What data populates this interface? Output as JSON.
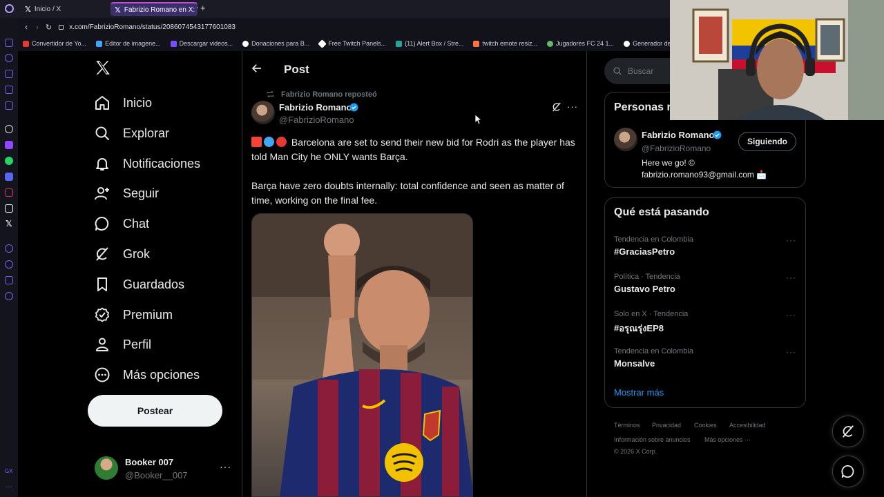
{
  "browser": {
    "tabs": [
      {
        "label": "Inicio / X"
      },
      {
        "label": "Fabrizio Romano en X: \"🚨 !"
      }
    ],
    "url": "x.com/FabrizioRomano/status/2086074543177601083",
    "bookmarks": [
      {
        "label": "Convertidor de Yo...",
        "color": "#e53935"
      },
      {
        "label": "Editor de imagene...",
        "color": "#42a5f5"
      },
      {
        "label": "Descargar videos...",
        "color": "#7c4dff"
      },
      {
        "label": "Donaciones para B...",
        "color": "#ffffff"
      },
      {
        "label": "Free Twitch Panels...",
        "color": "#ffffff"
      },
      {
        "label": "(11) Alert Box / Stre...",
        "color": "#26a69a"
      },
      {
        "label": "twitch emote resiz...",
        "color": "#ff7043"
      },
      {
        "label": "Jugadores FC 24 1...",
        "color": "#66bb6a"
      },
      {
        "label": "Generador de Voz...",
        "color": "#ffffff"
      }
    ]
  },
  "nav": {
    "items": [
      {
        "label": "Inicio",
        "icon": "home-icon"
      },
      {
        "label": "Explorar",
        "icon": "search-icon"
      },
      {
        "label": "Notificaciones",
        "icon": "bell-icon"
      },
      {
        "label": "Seguir",
        "icon": "add-person-icon"
      },
      {
        "label": "Chat",
        "icon": "chat-icon"
      },
      {
        "label": "Grok",
        "icon": "grok-icon"
      },
      {
        "label": "Guardados",
        "icon": "bookmark-icon"
      },
      {
        "label": "Premium",
        "icon": "premium-icon"
      },
      {
        "label": "Perfil",
        "icon": "person-icon"
      },
      {
        "label": "Más opciones",
        "icon": "more-circle-icon"
      }
    ],
    "post_button": "Postear",
    "account": {
      "name": "Booker 007",
      "handle": "@Booker__007"
    }
  },
  "post": {
    "header": "Post",
    "repost_label": "Fabrizio Romano reposteó",
    "author_name": "Fabrizio Romano",
    "author_handle": "@FabrizioRomano",
    "paragraph1": "Barcelona are set to send their new bid for Rodri as the player has told Man City he ONLY wants Barça.",
    "paragraph2": "Barça have zero doubts internally: total confidence and seen as matter of time, working on the final fee."
  },
  "right": {
    "search_placeholder": "Buscar",
    "who_to_follow_title": "Personas r",
    "profile": {
      "name": "Fabrizio Romano",
      "handle": "@FabrizioRomano",
      "follow_label": "Siguiendo",
      "bio1": "Here we go! ©",
      "bio2": "fabrizio.romano93@gmail.com 📩"
    },
    "trends_title": "Qué está pasando",
    "trends": [
      {
        "meta": "Tendencia en Colombia",
        "name": "#GraciasPetro"
      },
      {
        "meta": "Política · Tendencia",
        "name": "Gustavo Petro"
      },
      {
        "meta": "Solo en X · Tendencia",
        "name": "#อรุณรุ่งEP8"
      },
      {
        "meta": "Tendencia en Colombia",
        "name": "Monsalve"
      }
    ],
    "show_more": "Mostrar más",
    "footer": {
      "terms": "Términos",
      "privacy": "Privacidad",
      "cookies": "Cookies",
      "accessibility": "Accesibilidad",
      "ads": "Información sobre anuncios",
      "more": "Más opciones ···",
      "copyright": "© 2026 X Corp."
    }
  },
  "colors": {
    "accent": "#1d9bf0",
    "background": "#000000",
    "border": "#2f3336",
    "muted": "#71767b"
  }
}
